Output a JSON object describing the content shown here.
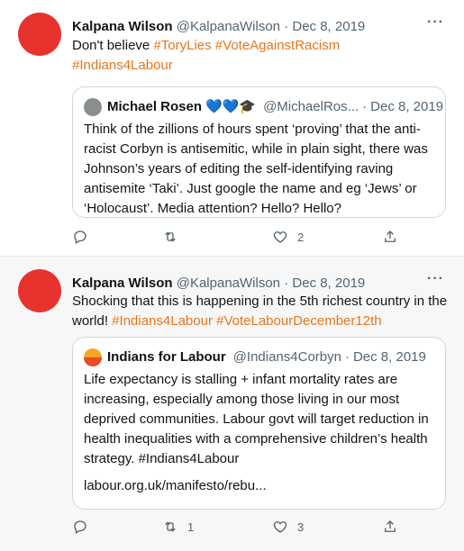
{
  "tweets": [
    {
      "author_name": "Kalpana Wilson",
      "author_handle": "@KalpanaWilson",
      "dot": "·",
      "date": "Dec 8, 2019",
      "more": "···",
      "text_plain": "Don't believe ",
      "tag1": "#ToryLies",
      "tag2": "#VoteAgainstRacism",
      "tag3": "#Indians4Labour",
      "quote": {
        "name": "Michael Rosen",
        "badge": "💙💙🎓",
        "handle": "@MichaelRos...",
        "dot": "·",
        "date": "Dec 8, 2019",
        "text": "Think of the zillions of hours spent ‘proving’ that the anti-racist Corbyn is antisemitic, while in plain sight, there was Johnson’s years of editing the self-identifying raving antisemite ‘Taki’. Just google the name and eg ‘Jews’ or ‘Holocaust’. Media attention? Hello? Hello?"
      },
      "actions": {
        "reply_count": "",
        "retweet_count": "",
        "like_count": "2"
      }
    },
    {
      "author_name": "Kalpana Wilson",
      "author_handle": "@KalpanaWilson",
      "dot": "·",
      "date": "Dec 8, 2019",
      "more": "···",
      "text_plain": "Shocking that this is happening in the 5th richest country in the world! ",
      "tag1": "#Indians4Labour",
      "tag2": "#VoteLabourDecember12th",
      "quote": {
        "name": "Indians for Labour",
        "handle": "@Indians4Corbyn",
        "dot": "·",
        "date": "Dec 8, 2019",
        "text": "Life expectancy is stalling + infant mortality rates are increasing, especially among those living in our most deprived communities. Labour govt will target reduction in health inequalities with a comprehensive children’s health strategy. #Indians4Labour",
        "link": "labour.org.uk/manifesto/rebu..."
      },
      "actions": {
        "reply_count": "",
        "retweet_count": "1",
        "like_count": "3"
      }
    }
  ],
  "colors": {
    "accent": "#e5761c",
    "avatar": "#e8322e",
    "muted": "#536471"
  }
}
